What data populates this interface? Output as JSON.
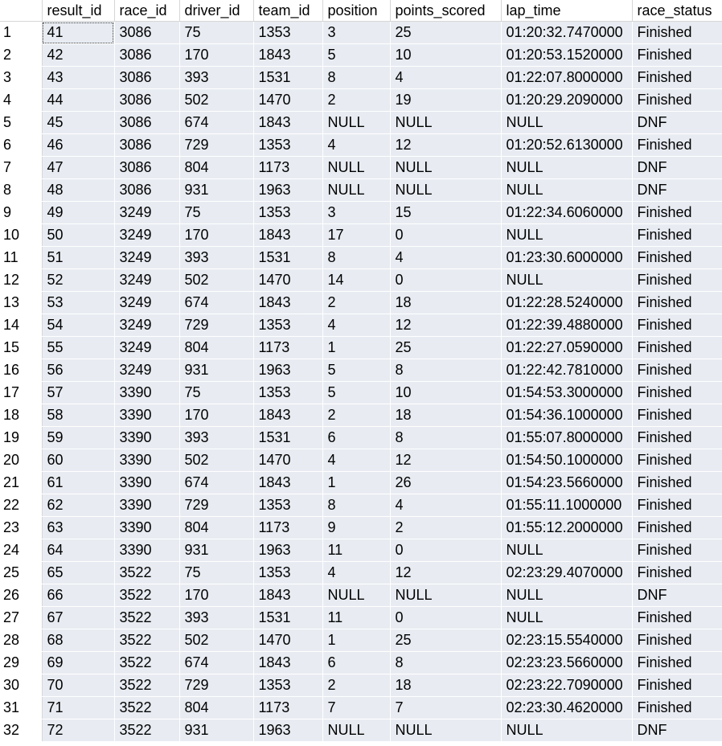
{
  "grid": {
    "columns": [
      "result_id",
      "race_id",
      "driver_id",
      "team_id",
      "position",
      "points_scored",
      "lap_time",
      "race_status"
    ],
    "rows": [
      [
        "1",
        "41",
        "3086",
        "75",
        "1353",
        "3",
        "25",
        "01:20:32.7470000",
        "Finished"
      ],
      [
        "2",
        "42",
        "3086",
        "170",
        "1843",
        "5",
        "10",
        "01:20:53.1520000",
        "Finished"
      ],
      [
        "3",
        "43",
        "3086",
        "393",
        "1531",
        "8",
        "4",
        "01:22:07.8000000",
        "Finished"
      ],
      [
        "4",
        "44",
        "3086",
        "502",
        "1470",
        "2",
        "19",
        "01:20:29.2090000",
        "Finished"
      ],
      [
        "5",
        "45",
        "3086",
        "674",
        "1843",
        "NULL",
        "NULL",
        "NULL",
        "DNF"
      ],
      [
        "6",
        "46",
        "3086",
        "729",
        "1353",
        "4",
        "12",
        "01:20:52.6130000",
        "Finished"
      ],
      [
        "7",
        "47",
        "3086",
        "804",
        "1173",
        "NULL",
        "NULL",
        "NULL",
        "DNF"
      ],
      [
        "8",
        "48",
        "3086",
        "931",
        "1963",
        "NULL",
        "NULL",
        "NULL",
        "DNF"
      ],
      [
        "9",
        "49",
        "3249",
        "75",
        "1353",
        "3",
        "15",
        "01:22:34.6060000",
        "Finished"
      ],
      [
        "10",
        "50",
        "3249",
        "170",
        "1843",
        "17",
        "0",
        "NULL",
        "Finished"
      ],
      [
        "11",
        "51",
        "3249",
        "393",
        "1531",
        "8",
        "4",
        "01:23:30.6000000",
        "Finished"
      ],
      [
        "12",
        "52",
        "3249",
        "502",
        "1470",
        "14",
        "0",
        "NULL",
        "Finished"
      ],
      [
        "13",
        "53",
        "3249",
        "674",
        "1843",
        "2",
        "18",
        "01:22:28.5240000",
        "Finished"
      ],
      [
        "14",
        "54",
        "3249",
        "729",
        "1353",
        "4",
        "12",
        "01:22:39.4880000",
        "Finished"
      ],
      [
        "15",
        "55",
        "3249",
        "804",
        "1173",
        "1",
        "25",
        "01:22:27.0590000",
        "Finished"
      ],
      [
        "16",
        "56",
        "3249",
        "931",
        "1963",
        "5",
        "8",
        "01:22:42.7810000",
        "Finished"
      ],
      [
        "17",
        "57",
        "3390",
        "75",
        "1353",
        "5",
        "10",
        "01:54:53.3000000",
        "Finished"
      ],
      [
        "18",
        "58",
        "3390",
        "170",
        "1843",
        "2",
        "18",
        "01:54:36.1000000",
        "Finished"
      ],
      [
        "19",
        "59",
        "3390",
        "393",
        "1531",
        "6",
        "8",
        "01:55:07.8000000",
        "Finished"
      ],
      [
        "20",
        "60",
        "3390",
        "502",
        "1470",
        "4",
        "12",
        "01:54:50.1000000",
        "Finished"
      ],
      [
        "21",
        "61",
        "3390",
        "674",
        "1843",
        "1",
        "26",
        "01:54:23.5660000",
        "Finished"
      ],
      [
        "22",
        "62",
        "3390",
        "729",
        "1353",
        "8",
        "4",
        "01:55:11.1000000",
        "Finished"
      ],
      [
        "23",
        "63",
        "3390",
        "804",
        "1173",
        "9",
        "2",
        "01:55:12.2000000",
        "Finished"
      ],
      [
        "24",
        "64",
        "3390",
        "931",
        "1963",
        "11",
        "0",
        "NULL",
        "Finished"
      ],
      [
        "25",
        "65",
        "3522",
        "75",
        "1353",
        "4",
        "12",
        "02:23:29.4070000",
        "Finished"
      ],
      [
        "26",
        "66",
        "3522",
        "170",
        "1843",
        "NULL",
        "NULL",
        "NULL",
        "DNF"
      ],
      [
        "27",
        "67",
        "3522",
        "393",
        "1531",
        "11",
        "0",
        "NULL",
        "Finished"
      ],
      [
        "28",
        "68",
        "3522",
        "502",
        "1470",
        "1",
        "25",
        "02:23:15.5540000",
        "Finished"
      ],
      [
        "29",
        "69",
        "3522",
        "674",
        "1843",
        "6",
        "8",
        "02:23:23.5660000",
        "Finished"
      ],
      [
        "30",
        "70",
        "3522",
        "729",
        "1353",
        "2",
        "18",
        "02:23:22.7090000",
        "Finished"
      ],
      [
        "31",
        "71",
        "3522",
        "804",
        "1173",
        "7",
        "7",
        "02:23:30.4620000",
        "Finished"
      ],
      [
        "32",
        "72",
        "3522",
        "931",
        "1963",
        "NULL",
        "NULL",
        "NULL",
        "DNF"
      ]
    ]
  },
  "colors": {
    "cell_background": "#e8ecf2",
    "header_background": "#ffffff",
    "text": "#000000",
    "gridline": "#d6d6d6"
  }
}
